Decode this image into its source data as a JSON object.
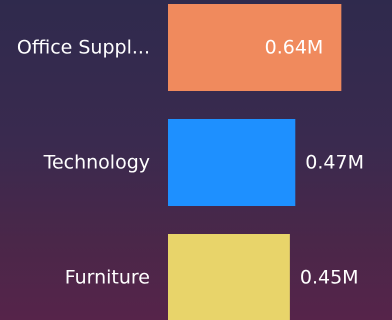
{
  "chart_data": {
    "type": "bar",
    "orientation": "horizontal",
    "categories": [
      "Office Suppl...",
      "Technology",
      "Furniture"
    ],
    "values": [
      0.64,
      0.47,
      0.45
    ],
    "value_labels": [
      "0.64M",
      "0.47M",
      "0.45M"
    ],
    "colors": [
      "#f08a5d",
      "#1e90ff",
      "#e8d46a"
    ],
    "unit": "M",
    "xlim": [
      0,
      0.72
    ],
    "title": "",
    "xlabel": "",
    "ylabel": "",
    "grid": false,
    "legend": "none"
  }
}
